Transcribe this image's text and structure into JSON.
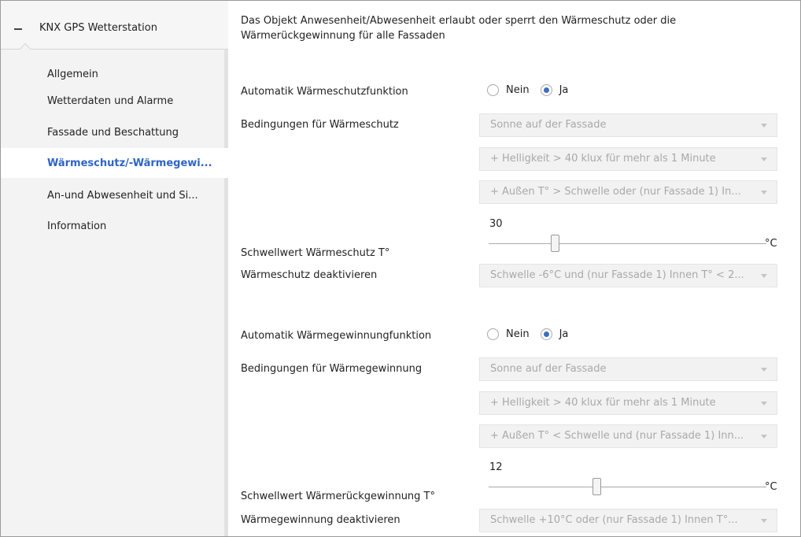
{
  "sidebar": {
    "title": "KNX GPS Wetterstation",
    "items": [
      {
        "label": "Allgemein"
      },
      {
        "label": "Wetterdaten und Alarme"
      },
      {
        "label": "Fassade und Beschattung"
      },
      {
        "label": "Wärmeschutz/-Wärmegewi..."
      },
      {
        "label": "An-und Abwesenheit und Si..."
      },
      {
        "label": "Information"
      }
    ],
    "active_index": 3
  },
  "main": {
    "description": "Das Objekt Anwesenheit/Abwesenheit erlaubt oder sperrt den Wärmeschutz oder die Wärmerückgewinnung für alle Fassaden",
    "heat_protection": {
      "auto_label": "Automatik Wärmeschutzfunktion",
      "option_no": "Nein",
      "option_yes": "Ja",
      "selected": "Ja",
      "conditions_label": "Bedingungen für Wärmeschutz",
      "condition_1": "Sonne auf der Fassade",
      "condition_2": "+ Helligkeit > 40 klux für mehr als 1 Minute",
      "condition_3": "+ Außen T° > Schwelle oder (nur Fassade 1) In...",
      "threshold_label": "Schwellwert Wärmeschutz T°",
      "threshold_value": "30",
      "threshold_fraction": 0.24,
      "unit": "°C",
      "deactivate_label": "Wärmeschutz deaktivieren",
      "deactivate_value": "Schwelle -6°C und (nur Fassade 1) Innen T° < 2..."
    },
    "heat_gain": {
      "auto_label": "Automatik Wärmegewinnungfunktion",
      "option_no": "Nein",
      "option_yes": "Ja",
      "selected": "Ja",
      "conditions_label": "Bedingungen für Wärmegewinnung",
      "condition_1": "Sonne auf der Fassade",
      "condition_2": "+ Helligkeit > 40 klux für mehr als 1 Minute",
      "condition_3": "+ Außen T° < Schwelle und (nur Fassade 1) Inn...",
      "threshold_label": "Schwellwert Wärmerückgewinnung T°",
      "threshold_value": "12",
      "threshold_fraction": 0.39,
      "unit": "°C",
      "deactivate_label": "Wärmegewinnung deaktivieren",
      "deactivate_value": "Schwelle +10°C oder (nur Fassade 1) Innen T°..."
    }
  },
  "colors": {
    "accent": "#2e64c8",
    "radio_fill": "#3c6fbf",
    "sidebar_bg": "#f3f3f3",
    "disabled_text": "#a9a9a9"
  }
}
